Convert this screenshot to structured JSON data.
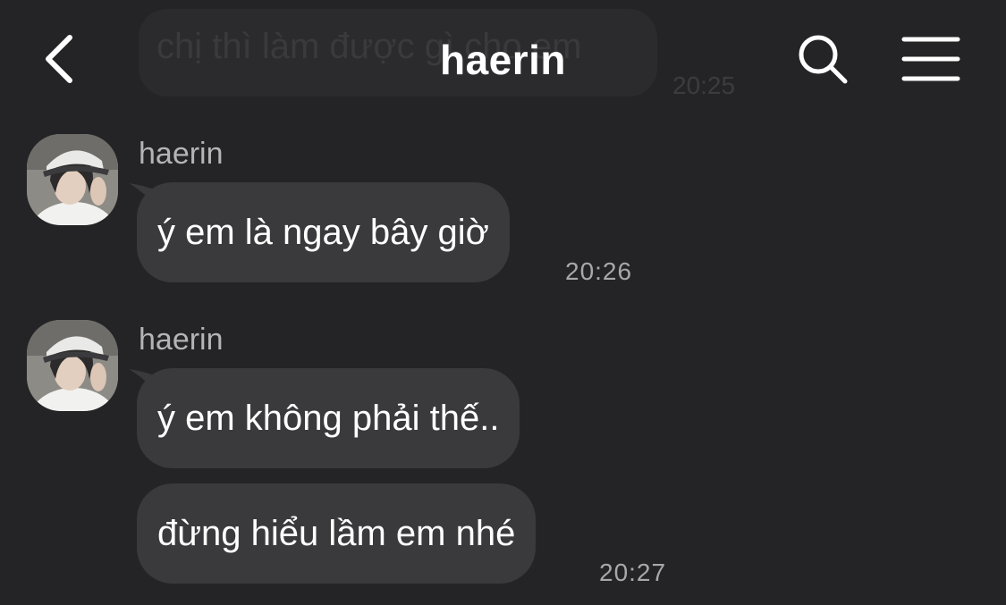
{
  "header": {
    "title": "haerin",
    "back_icon": "chevron-left-icon",
    "search_icon": "search-icon",
    "menu_icon": "hamburger-menu-icon"
  },
  "previous_message": {
    "text": "chị thì làm được gì cho em",
    "time": "20:25"
  },
  "groups": [
    {
      "sender": "haerin",
      "messages": [
        "ý em là ngay bây giờ"
      ],
      "time": "20:26"
    },
    {
      "sender": "haerin",
      "messages": [
        "ý em không phải thế..",
        "đừng hiểu lầm em nhé"
      ],
      "time": "20:27"
    }
  ],
  "colors": {
    "background": "#242426",
    "bubble": "#3a3a3c",
    "text": "#ffffff",
    "meta_text": "#a8a8ab"
  }
}
